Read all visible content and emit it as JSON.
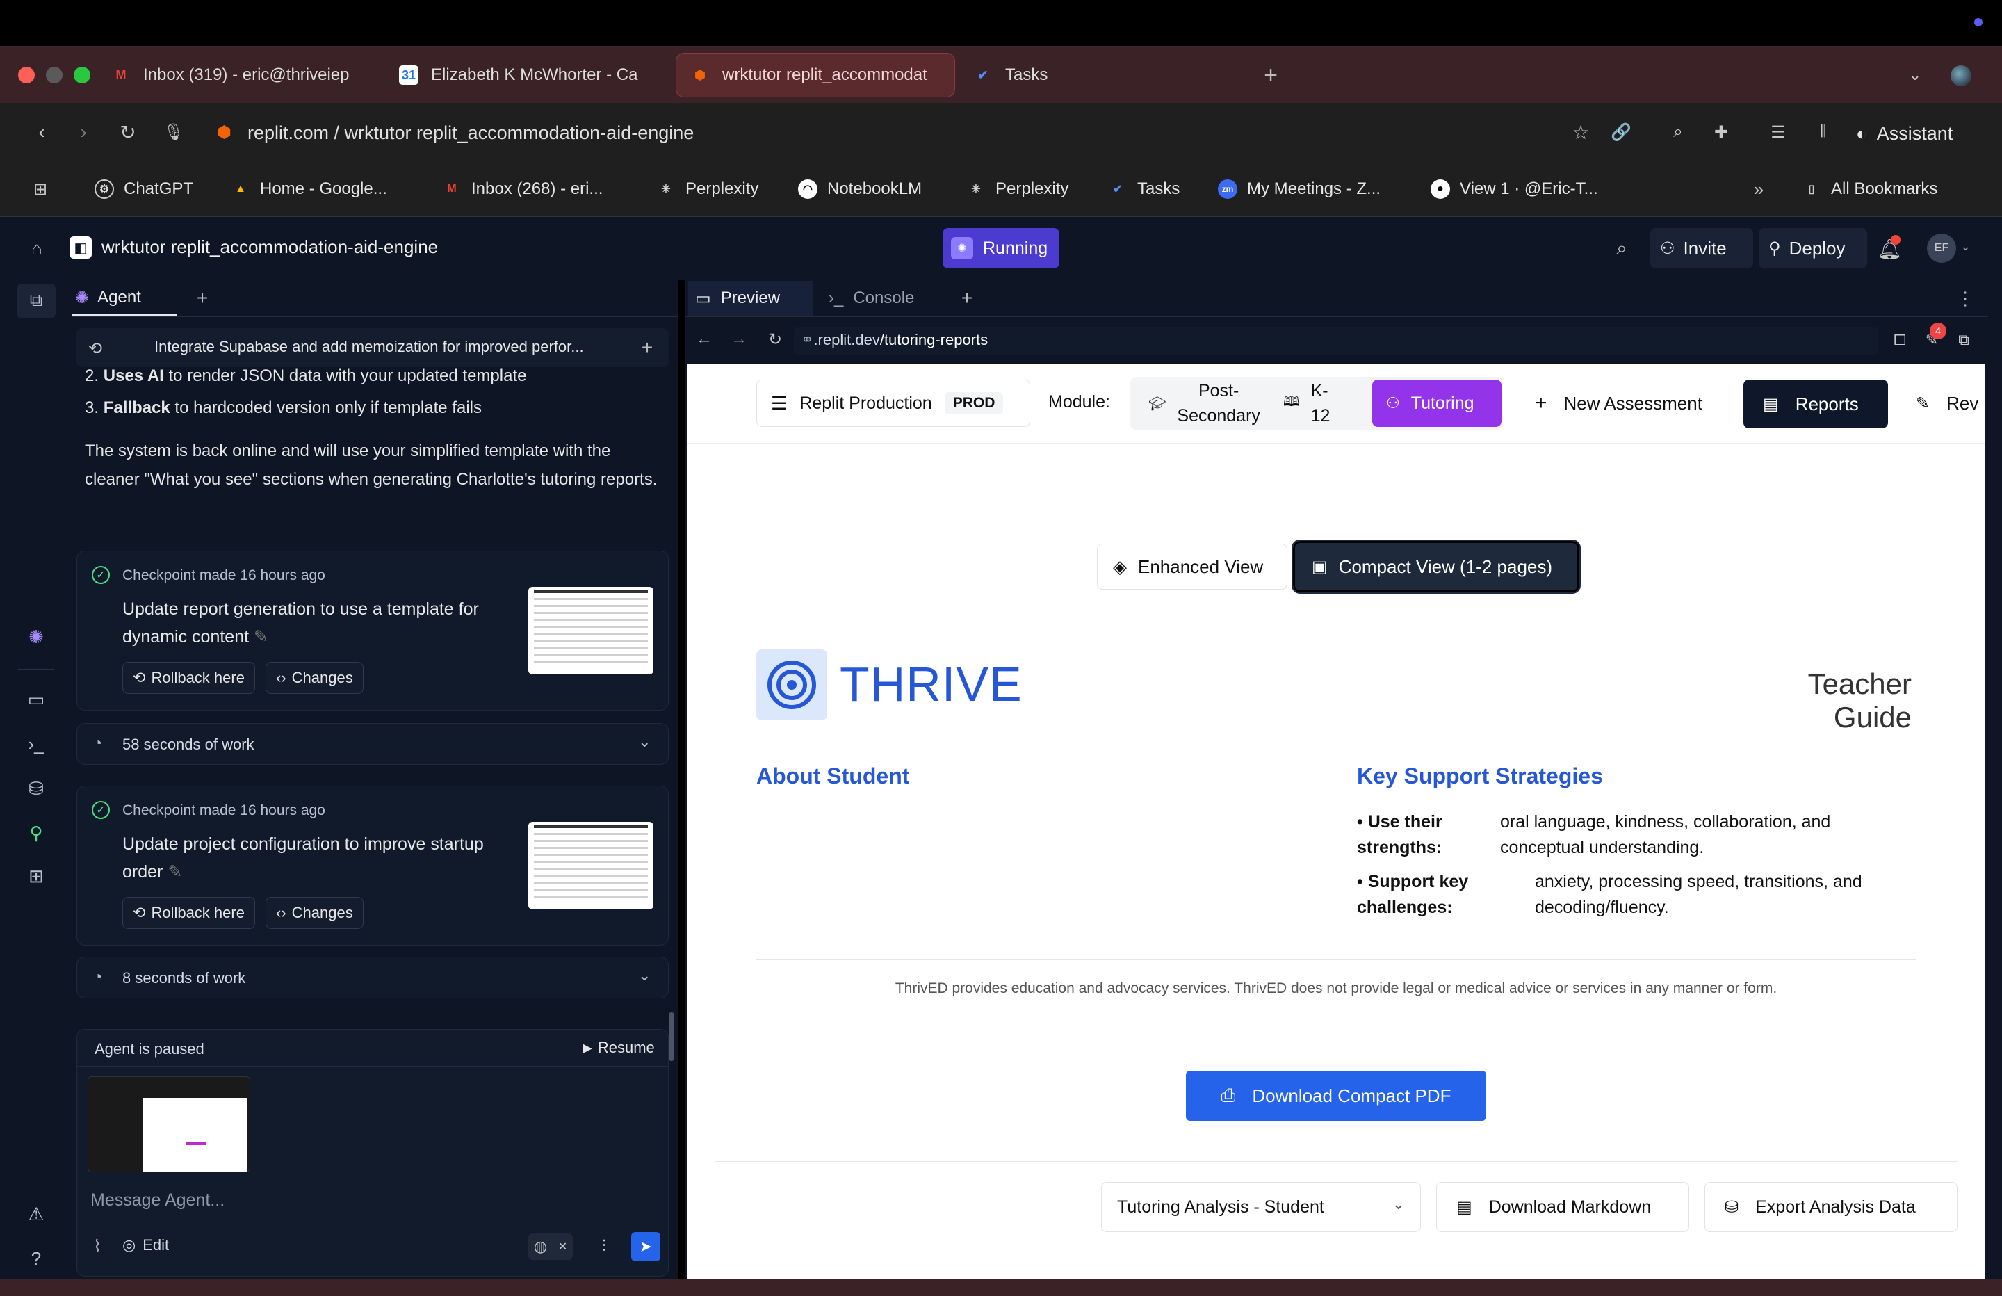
{
  "browser": {
    "tabs": [
      {
        "label": "Inbox (319) - eric@thriveiep"
      },
      {
        "label": "Elizabeth K McWhorter - Ca"
      },
      {
        "label": "wrktutor replit_accommodat"
      },
      {
        "label": "Tasks"
      }
    ],
    "calendar_badge": "31",
    "address": "replit.com / wrktutor replit_accommodation-aid-engine",
    "assistant_label": "Assistant",
    "bookmarks": [
      {
        "label": "ChatGPT"
      },
      {
        "label": "Home - Google..."
      },
      {
        "label": "Inbox (268) - eri..."
      },
      {
        "label": "Perplexity"
      },
      {
        "label": "NotebookLM"
      },
      {
        "label": "Perplexity"
      },
      {
        "label": "Tasks"
      },
      {
        "label": "My Meetings - Z..."
      },
      {
        "label": "View 1 · @Eric-T..."
      }
    ],
    "zoom_icon_label": "zm",
    "all_bookmarks": "All Bookmarks"
  },
  "replit": {
    "project_title": "wrktutor replit_accommodation-aid-engine",
    "status": "Running",
    "invite": "Invite",
    "deploy": "Deploy",
    "avatar": "EF",
    "agent_tab": "Agent",
    "history_title": "Integrate Supabase and add memoization for improved perfor...",
    "msg_item2_bold": "Uses AI",
    "msg_item2_rest": " to render JSON data with your updated template",
    "msg_item3_bold": "Fallback",
    "msg_item3_rest": " to hardcoded version only if template fails",
    "msg_item2_num": "2.",
    "msg_item3_num": "3.",
    "msg_paragraph": "The system is back online and will use your simplified template with the cleaner \"What you see\" sections when generating Charlotte's tutoring reports.",
    "checkpoints": [
      {
        "meta": "Checkpoint made 16 hours ago",
        "title": "Update report generation to use a template for dynamic content",
        "rollback": "Rollback here",
        "changes": "Changes"
      },
      {
        "meta": "Checkpoint made 16 hours ago",
        "title": "Update project configuration to improve startup order",
        "rollback": "Rollback here",
        "changes": "Changes"
      }
    ],
    "work1": "58 seconds of work",
    "work2": "8 seconds of work",
    "paused": "Agent is paused",
    "resume": "Resume",
    "message_placeholder": "Message Agent...",
    "edit": "Edit",
    "preview_tab": "Preview",
    "console_tab": "Console",
    "preview_url_prefix": ".replit.dev",
    "preview_url_path": "/tutoring-reports",
    "tools_badge": "4"
  },
  "app": {
    "env_label": "Replit Production",
    "env_badge": "PROD",
    "module_label": "Module:",
    "modules": [
      {
        "label": "Post-\nSecondary"
      },
      {
        "label": "K-\n12"
      },
      {
        "label": "Tutoring"
      }
    ],
    "new_assessment": "New Assessment",
    "reports": "Reports",
    "rev": "Rev",
    "enhanced_view": "Enhanced View",
    "compact_view": "Compact View (1-2 pages)",
    "brand": "THRIVE",
    "guide_title": "Teacher Guide",
    "about_heading": "About Student",
    "strategies_heading": "Key Support Strategies",
    "strategies": [
      {
        "label": "• Use their strengths:",
        "text": "oral language, kindness, collaboration, and conceptual understanding."
      },
      {
        "label": "• Support key challenges:",
        "text": "anxiety, processing speed, transitions, and decoding/fluency."
      }
    ],
    "disclaimer": "ThrivED provides education and advocacy services. ThrivED does not provide legal or medical advice or services in any manner or form.",
    "download_pdf": "Download Compact PDF",
    "report_select": "Tutoring Analysis - Student",
    "download_md": "Download Markdown",
    "export_data": "Export Analysis Data"
  },
  "colors": {
    "accent_purple": "#7c3aed",
    "brand_blue": "#2563eb",
    "dark_navy": "#0f172a",
    "replit_bg": "#0e1525"
  }
}
